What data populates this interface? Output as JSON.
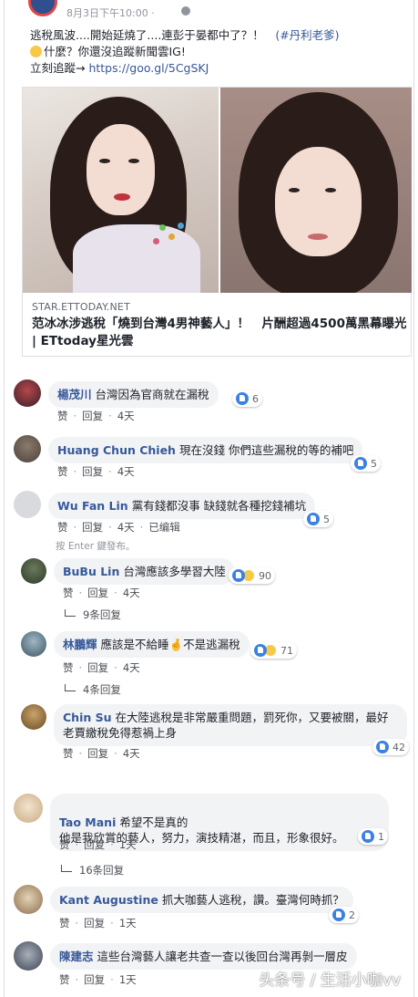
{
  "post": {
    "time": "8月3日下午10:00 · ",
    "line1": "逃稅風波....開始延燒了....連彭于晏都中了？！",
    "hashtag": "(#丹利老爹)",
    "line2": "什麼？你還沒追蹤新聞雲IG!",
    "line3_prefix": "立刻追蹤→ ",
    "link": "https://goo.gl/5CgSKJ"
  },
  "preview": {
    "source": "STAR.ETTODAY.NET",
    "title": "范冰冰涉逃稅「燒到台灣4男神藝人」！　片酬超過4500萬黑幕曝光 | ETtoday星光雲"
  },
  "comment_actions": {
    "like": "赞",
    "reply": "回复",
    "edited": "已编辑"
  },
  "partial_text": "按 Enter 鍵發布。",
  "comments": [
    {
      "name": "楊茂川",
      "text": "台灣因為官商就在漏稅",
      "time": "4天",
      "reactions": "6"
    },
    {
      "name": "Huang Chun Chieh",
      "text": "現在沒錢 你們這些漏稅的等的補吧",
      "time": "4天",
      "reactions": "5"
    },
    {
      "name": "Wu Fan Lin",
      "text": "黨有錢都沒事 缺錢就各種挖錢補坑",
      "time": "4天",
      "reactions": "5"
    },
    {
      "name": "BuBu Lin",
      "text": "台灣應該多學習大陸",
      "time": "4天",
      "reactions": "90",
      "replies": "9条回复"
    },
    {
      "name": "林鵬輝",
      "text": "應該是不給睡🤞不是逃漏稅",
      "time": "4天",
      "reactions": "71",
      "replies": "4条回复"
    },
    {
      "name": "Chin Su",
      "text": "在大陸逃稅是非常嚴重問題，罰死你，又要被關，最好老賈繳稅免得惹禍上身",
      "time": "4天",
      "reactions": "42"
    },
    {
      "name": "Tao Mani",
      "text": "希望不是真的\n他是我欣賞的藝人，努力，演技精湛，而且，形象很好。",
      "time": "1天",
      "reactions": "1",
      "replies": "16条回复"
    },
    {
      "name": "Kant Augustine",
      "text": "抓大咖藝人逃稅，讚。臺灣何時抓？",
      "time": "1天",
      "reactions": "2"
    },
    {
      "name": "陳建志",
      "text": "這些台灣藝人讓老共查一查以後回台灣再剝一層皮",
      "time": "1天"
    }
  ],
  "watermark": "头条号 / 生活小咖vv",
  "colors": {
    "link": "#365899",
    "bubble": "#f2f3f5",
    "like": "#3b82e0"
  }
}
